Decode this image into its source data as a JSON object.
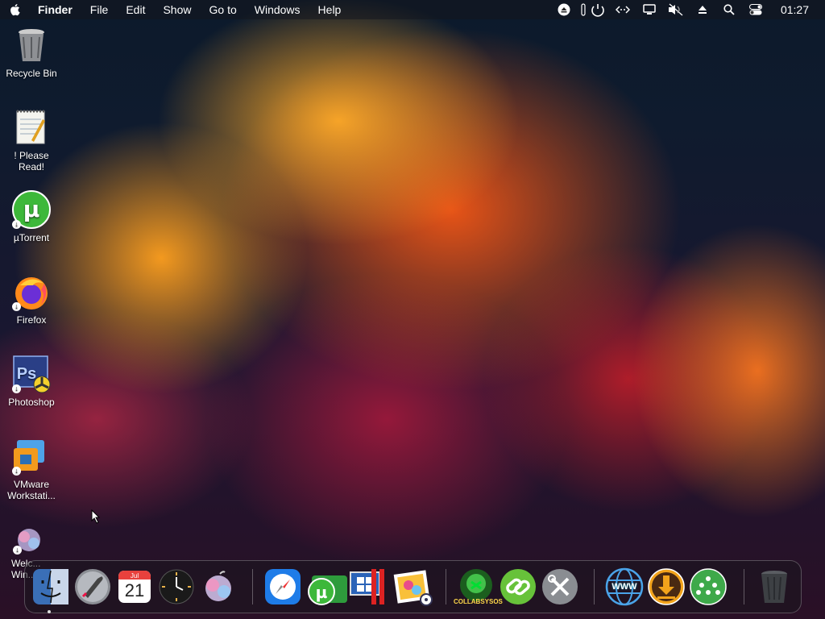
{
  "menubar": {
    "items": [
      "Finder",
      "File",
      "Edit",
      "Show",
      "Go to",
      "Windows",
      "Help"
    ],
    "clock": "01:27"
  },
  "desktop": {
    "icons": [
      {
        "label": "Recycle Bin"
      },
      {
        "label": "! Please Read!"
      },
      {
        "label": "µTorrent"
      },
      {
        "label": "Firefox"
      },
      {
        "label": "Photoshop"
      },
      {
        "label": "VMware Workstati..."
      },
      {
        "label": "Welc... Win..."
      }
    ]
  },
  "dock": {
    "calendar_month": "Jul",
    "calendar_day": "21",
    "collabsysos_label": "COLLABSYSOS",
    "www_label": "WWW"
  },
  "colors": {
    "utorrent_green": "#3db83a",
    "safari_blue": "#1e7ce8",
    "ps_blue": "#2a3f86"
  }
}
